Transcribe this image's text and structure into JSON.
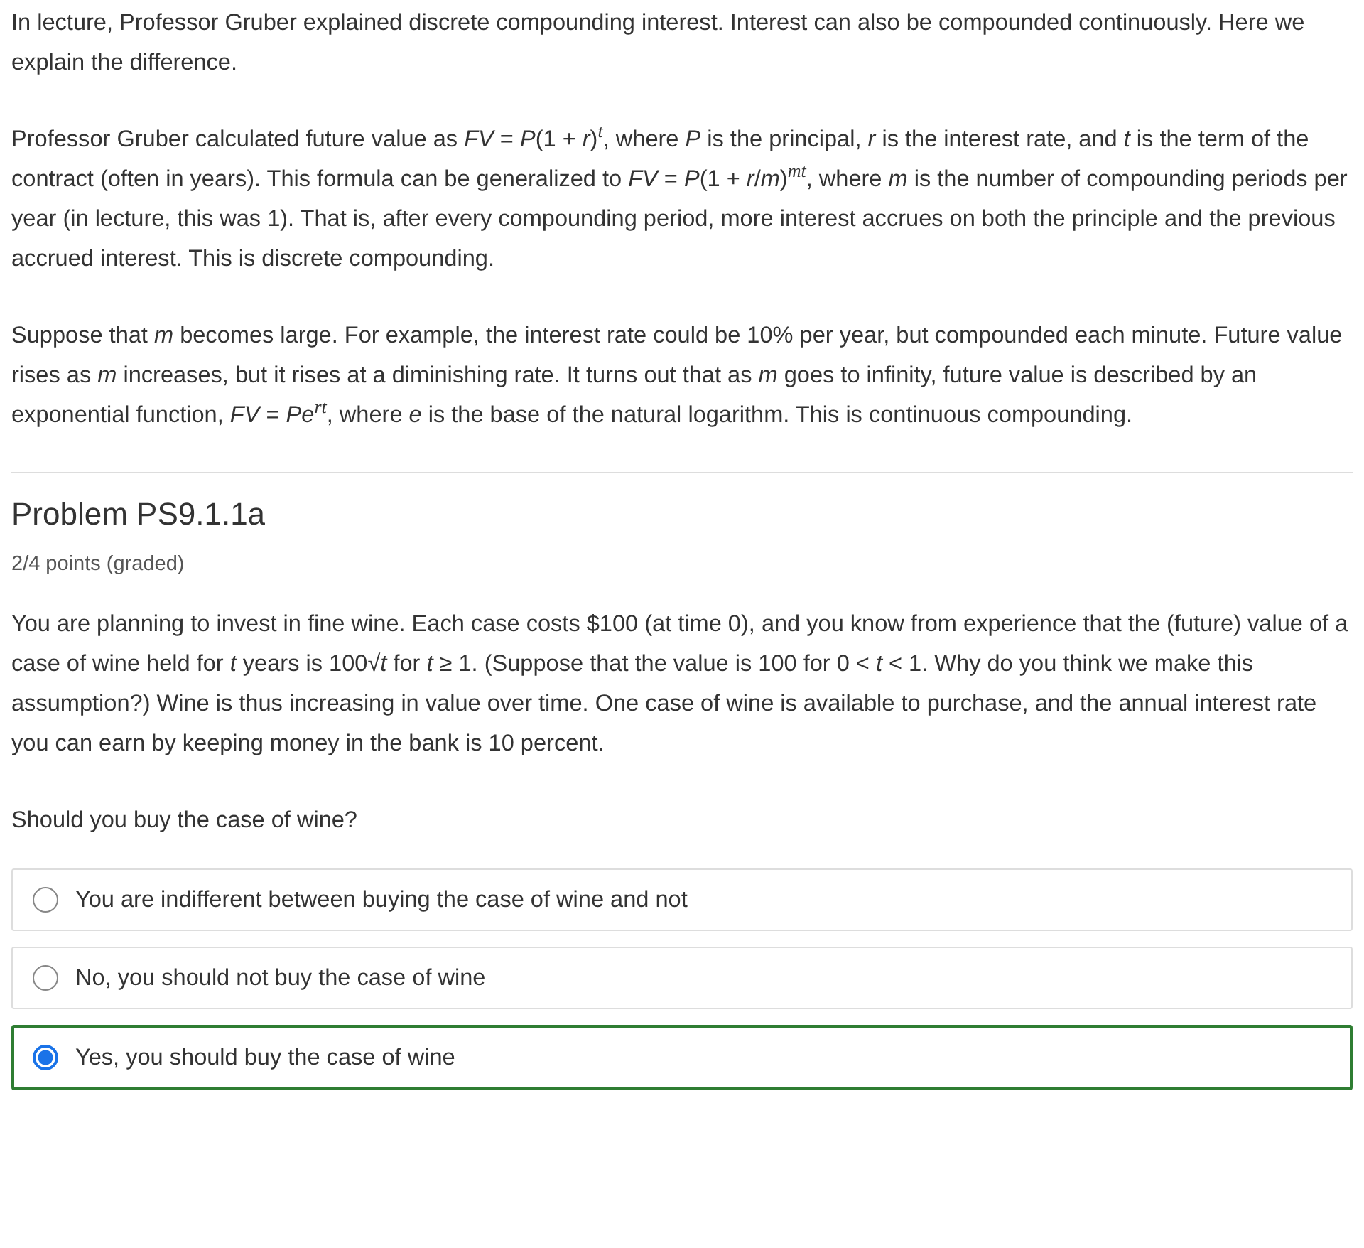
{
  "intro_paragraphs": [
    "In lecture, Professor Gruber explained discrete compounding interest. Interest can also be compounded continuously. Here we explain the difference.",
    "Professor Gruber calculated future value as *FV* = *P*(1 + *r*)$^{t}$, where *P* is the principal, *r* is the interest rate, and *t* is the term of the contract (often in years). This formula can be generalized to *FV* = *P*(1 + *r*/*m*)$^{mt}$, where *m* is the number of compounding periods per year (in lecture, this was 1). That is, after every compounding period, more interest accrues on both the principle and the previous accrued interest. This is discrete compounding.",
    "Suppose that *m* becomes large. For example, the interest rate could be 10% per year, but compounded each minute. Future value rises as *m* increases, but it rises at a diminishing rate. It turns out that as *m* goes to infinity, future value is described by an exponential function, *FV* = *Pe*$^{rt}$, where *e* is the base of the natural logarithm. This is continuous compounding."
  ],
  "problem": {
    "title": "Problem PS9.1.1a",
    "points": "2/4 points (graded)",
    "paragraphs": [
      "You are planning to invest in fine wine. Each case costs $100 (at time 0), and you know from experience that the (future) value of a case of wine held for *t* years is 100√*t* for *t* ≥ 1. (Suppose that the value is 100 for 0 < *t* < 1. Why do you think we make this assumption?) Wine is thus increasing in value over time. One case of wine is available to purchase, and the annual interest rate you can earn by keeping money in the bank is 10 percent."
    ],
    "question": "Should you buy the case of wine?",
    "options": [
      {
        "label": "You are indifferent between buying the case of wine and not",
        "selected": false
      },
      {
        "label": "No, you should not buy the case of wine",
        "selected": false
      },
      {
        "label": "Yes, you should buy the case of wine",
        "selected": true
      }
    ]
  }
}
